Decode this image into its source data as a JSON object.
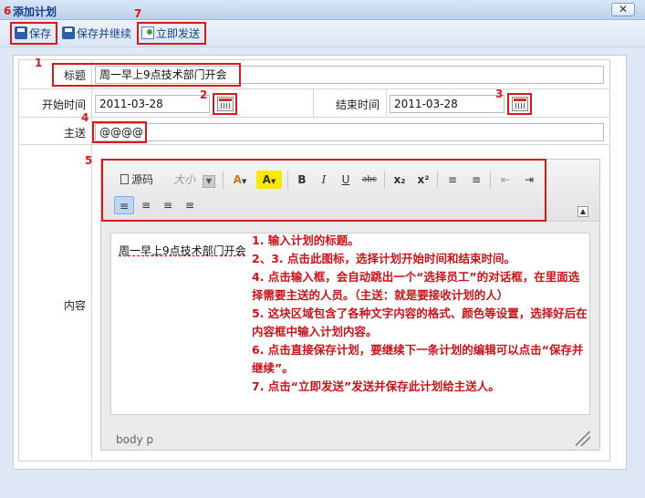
{
  "window": {
    "title": "添加计划",
    "close_label": "✕"
  },
  "toolbar": {
    "save_label": "保存",
    "save_continue_label": "保存并继续",
    "send_label": "立即发送"
  },
  "markers": [
    "1",
    "2",
    "3",
    "4",
    "5",
    "6",
    "7"
  ],
  "form": {
    "title_label": "标题",
    "title_value": "周一早上9点技术部门开会",
    "start_label": "开始时间",
    "start_value": "2011-03-28",
    "end_label": "结束时间",
    "end_value": "2011-03-28",
    "recipient_label": "主送",
    "recipient_value": "@@@@",
    "content_label": "内容"
  },
  "editor": {
    "source_label": "源码",
    "font_size_label": "大小",
    "bold": "B",
    "italic": "I",
    "underline": "U",
    "strike": "abc",
    "subscript": "x₂",
    "superscript": "x²",
    "ordered_list": "≡",
    "unordered_list": "≡",
    "outdent": "⇤",
    "indent": "⇥",
    "align_left": "≡",
    "align_center": "≡",
    "align_right": "≡",
    "align_justify": "≡",
    "collapse": "▲",
    "content": "周一早上9点技术部门开会",
    "path": "body  p"
  },
  "instructions": [
    "1. 输入计划的标题。",
    "2、3. 点击此图标，选择计划开始时间和结束时间。",
    "4. 点击输入框，会自动跳出一个“选择员工”的对话框，在里面选择需要主送的人员。（主送：就是要接收计划的人）",
    "5. 这块区域包含了各种文字内容的格式、颜色等设置，选择好后在内容框中输入计划内容。",
    "6. 点击直接保存计划，要继续下一条计划的编辑可以点击“保存并继续”。",
    "7. 点击“立即发送”发送并保存此计划给主送人。"
  ],
  "colors": {
    "annotation": "#d7191c",
    "title_text": "#15428b"
  }
}
